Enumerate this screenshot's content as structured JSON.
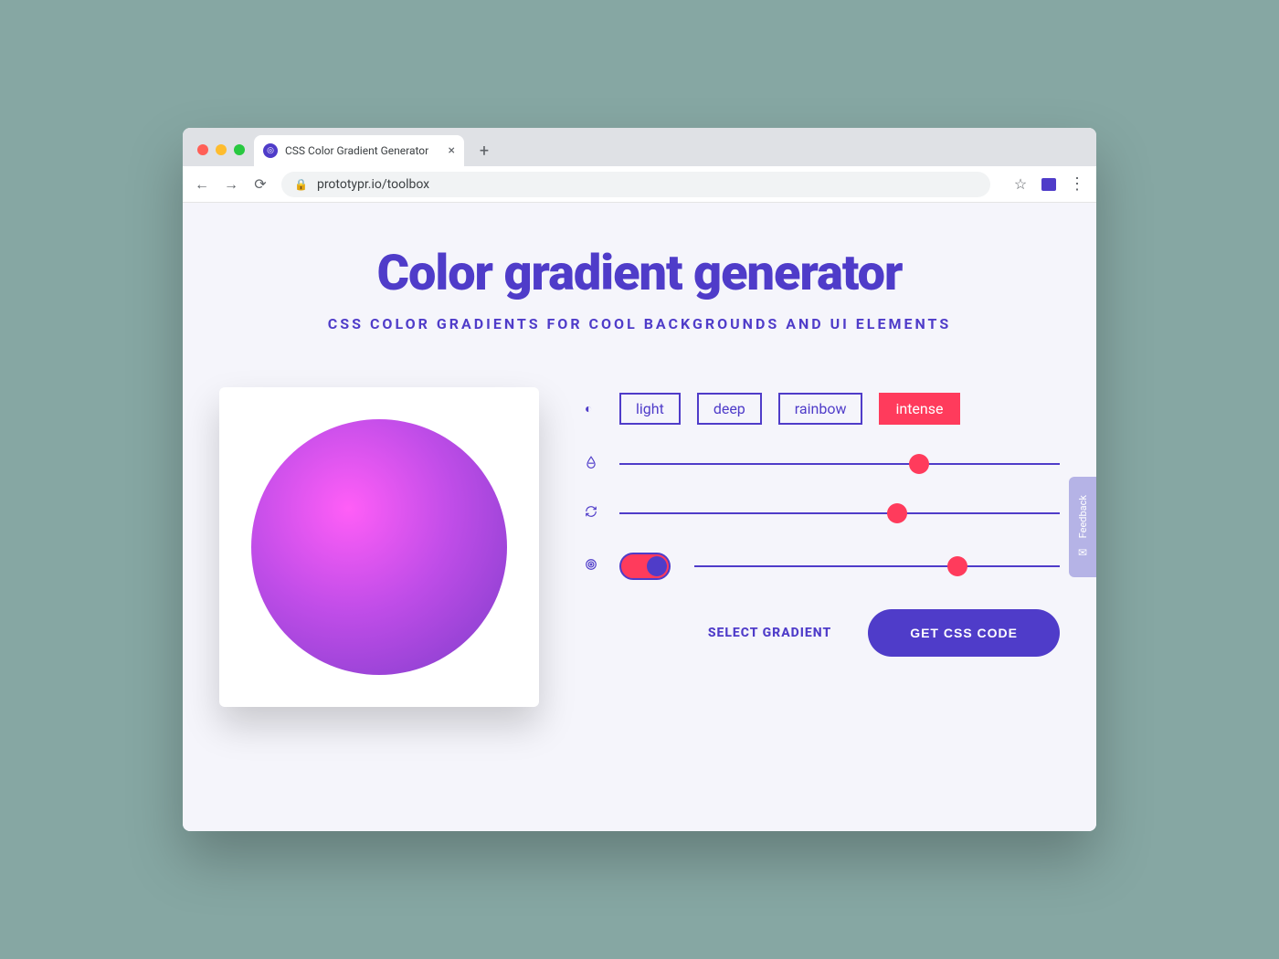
{
  "browser": {
    "tab_title": "CSS Color Gradient Generator",
    "url_display": "prototypr.io/toolbox"
  },
  "page": {
    "title": "Color gradient generator",
    "subtitle": "CSS COLOR GRADIENTS FOR COOL BACKGROUNDS AND UI ELEMENTS"
  },
  "presets": {
    "light": "light",
    "deep": "deep",
    "rainbow": "rainbow",
    "intense": "intense",
    "active": "intense"
  },
  "sliders": {
    "hue_percent": 68,
    "rotation_percent": 63,
    "scale_percent": 72
  },
  "toggle": {
    "on": true
  },
  "actions": {
    "select_label": "SELECT GRADIENT",
    "get_code_label": "GET CSS CODE"
  },
  "feedback": {
    "label": "Feedback"
  },
  "colors": {
    "primary": "#4f3cc9",
    "accent": "#ff3b5c",
    "gradient_start": "#ff5ef7",
    "gradient_end": "#7b3cc9"
  }
}
